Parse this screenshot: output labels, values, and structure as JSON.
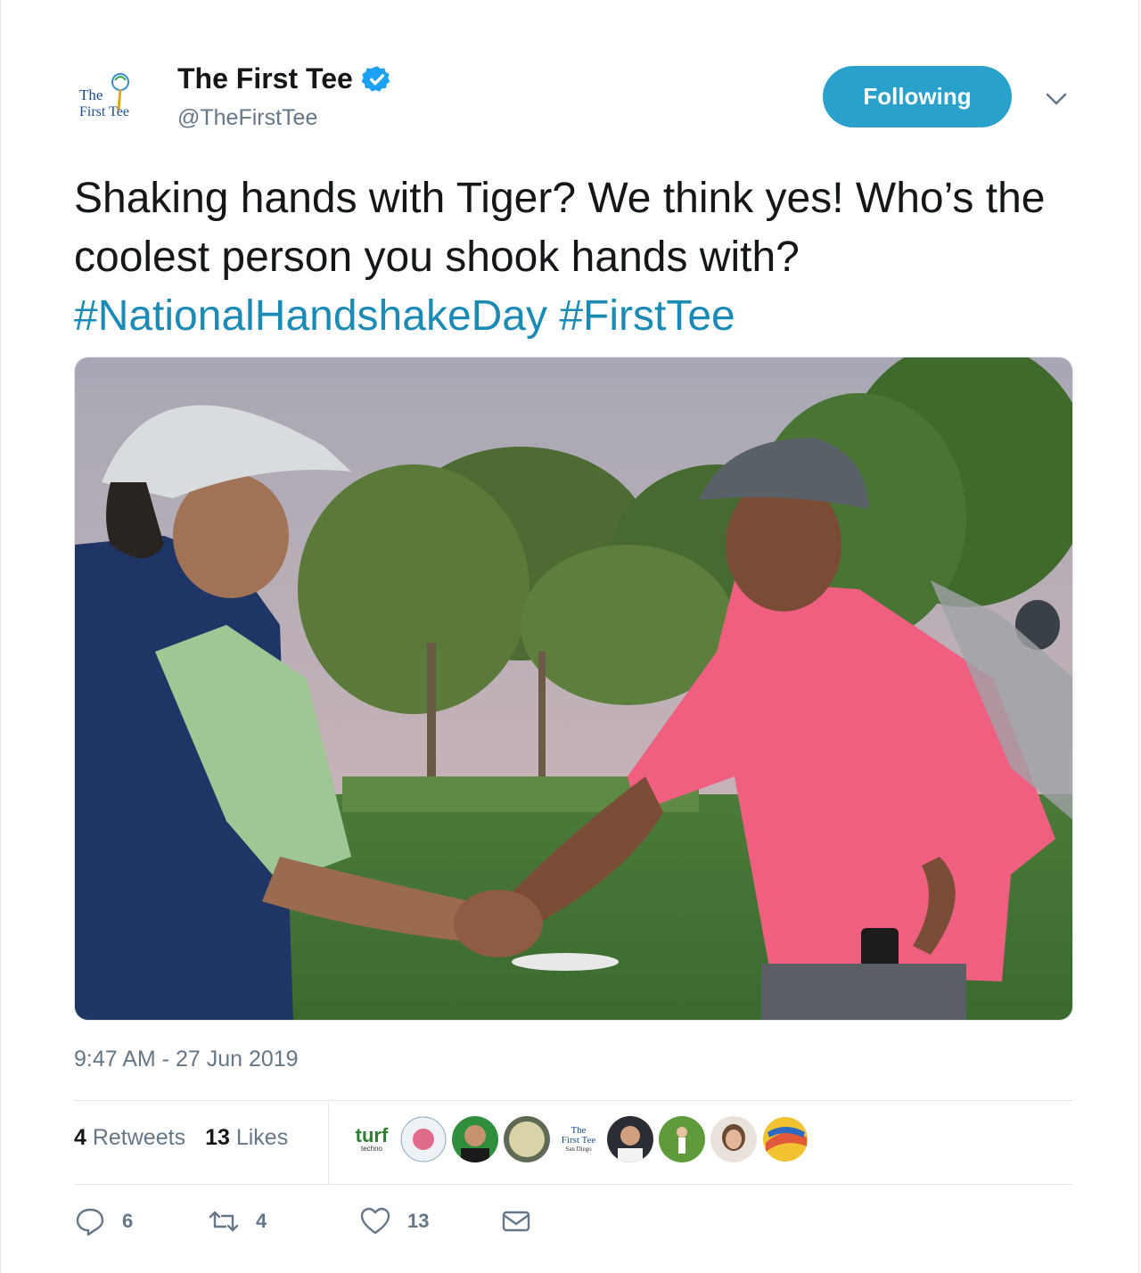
{
  "tweet": {
    "display_name": "The First Tee",
    "handle": "@TheFirstTee",
    "follow_label": "Following",
    "text_plain": "Shaking hands with Tiger? We think yes! Who’s the coolest person you shook hands with? ",
    "hashtag_1": "#NationalHandshakeDay",
    "hashtag_2": "#FirstTee",
    "timestamp": "9:47 AM - 27 Jun 2019"
  },
  "avatar_logo": {
    "line1": "The",
    "line2": "First Tee"
  },
  "stats": {
    "retweets_count": "4",
    "retweets_label": " Retweets",
    "likes_count": "13",
    "likes_label": " Likes"
  },
  "likers": {
    "turf_name": "turf",
    "turf_sub": "techno",
    "firsttee_sd_line1": "The",
    "firsttee_sd_line2": "First Tee",
    "firsttee_sd_line3": "San Diego"
  },
  "actions": {
    "reply_count": "6",
    "retweet_count": "4",
    "like_count": "13"
  },
  "colors": {
    "accent": "#2aa1cb",
    "hashtag": "#1b8bb5",
    "verified": "#1da1f2",
    "muted": "#657786"
  },
  "icons": [
    "verified-badge-icon",
    "chevron-down-icon",
    "reply-icon",
    "retweet-icon",
    "heart-icon",
    "mail-icon"
  ]
}
